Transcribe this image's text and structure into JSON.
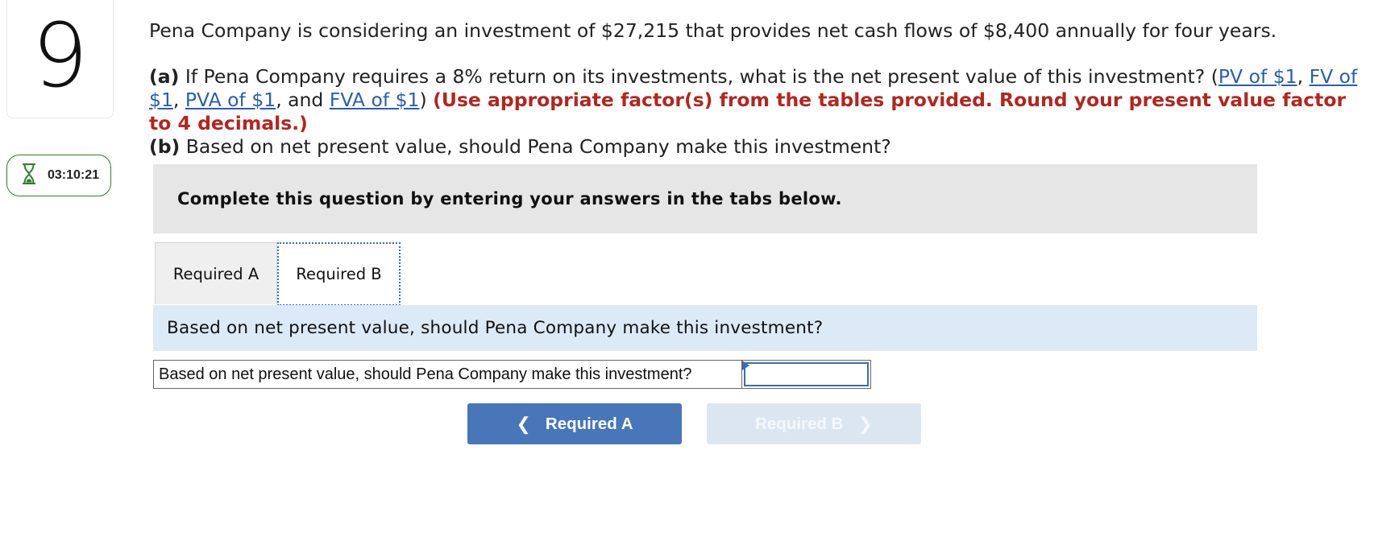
{
  "question": {
    "number": "9",
    "timer": "03:10:21",
    "intro": "Pena Company is considering an investment of $27,215 that provides net cash flows of $8,400 annually for four years.",
    "part_a_label": "(a)",
    "part_a_text": " If Pena Company requires a 8% return on its investments, what is the net present value of this investment? (",
    "links": [
      "PV of $1",
      "FV of $1",
      "PVA of $1",
      "FVA of $1"
    ],
    "sep_comma": ", ",
    "sep_and": ", and ",
    "close_paren": ") ",
    "instruction_red": "(Use appropriate factor(s) from the tables provided. Round your present value factor to 4 decimals.)",
    "part_b_label": "(b)",
    "part_b_text": " Based on net present value, should Pena Company make this investment?"
  },
  "instructions": "Complete this question by entering your answers in the tabs below.",
  "tabs": [
    {
      "label": "Required A",
      "active": false
    },
    {
      "label": "Required B",
      "active": true
    }
  ],
  "panel": {
    "prompt": "Based on net present value, should Pena Company make this investment?",
    "answer_label": "Based on net present value, should Pena Company make this investment?",
    "answer_value": ""
  },
  "nav": {
    "prev_label": "Required A",
    "next_label": "Required B",
    "prev_enabled": true,
    "next_enabled": false
  },
  "colors": {
    "accent": "#4876b8",
    "link": "#2a5db0",
    "red": "#b3261e",
    "timer_border": "#2e7d32"
  },
  "icons": [
    "hourglass-icon",
    "chevron-left-icon",
    "chevron-right-icon"
  ]
}
